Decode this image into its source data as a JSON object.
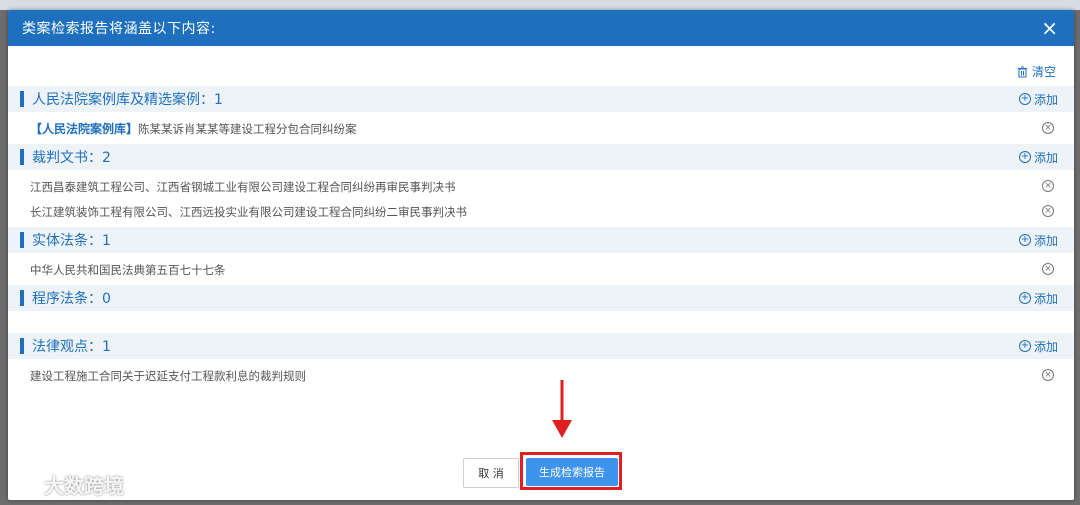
{
  "modal": {
    "title": "类案检索报告将涵盖以下内容:",
    "close_icon": "×",
    "clear_label": "清空",
    "add_label": "添加"
  },
  "sections": [
    {
      "title": "人民法院案例库及精选案例：1",
      "items": [
        {
          "tag": "【人民法院案例库】",
          "text": "陈某某诉肖某某等建设工程分包合同纠纷案"
        }
      ]
    },
    {
      "title": "裁判文书：2",
      "items": [
        {
          "tag": "",
          "text": "江西昌泰建筑工程公司、江西省钢城工业有限公司建设工程合同纠纷再审民事判决书"
        },
        {
          "tag": "",
          "text": "长江建筑装饰工程有限公司、江西远投实业有限公司建设工程合同纠纷二审民事判决书"
        }
      ]
    },
    {
      "title": "实体法条：1",
      "items": [
        {
          "tag": "",
          "text": "中华人民共和国民法典第五百七十七条"
        }
      ]
    },
    {
      "title": "程序法条：0",
      "items": []
    },
    {
      "title": "法律观点：1",
      "items": [
        {
          "tag": "",
          "text": "建设工程施工合同关于迟延支付工程款利息的裁判规则"
        }
      ]
    }
  ],
  "footer": {
    "cancel_label": "取 消",
    "generate_label": "生成检索报告"
  },
  "watermark": {
    "text": "大数跨境"
  },
  "colors": {
    "primary": "#1e70be",
    "button": "#3e93ef",
    "highlight": "#e02020",
    "section_bg": "#eef3f8"
  }
}
